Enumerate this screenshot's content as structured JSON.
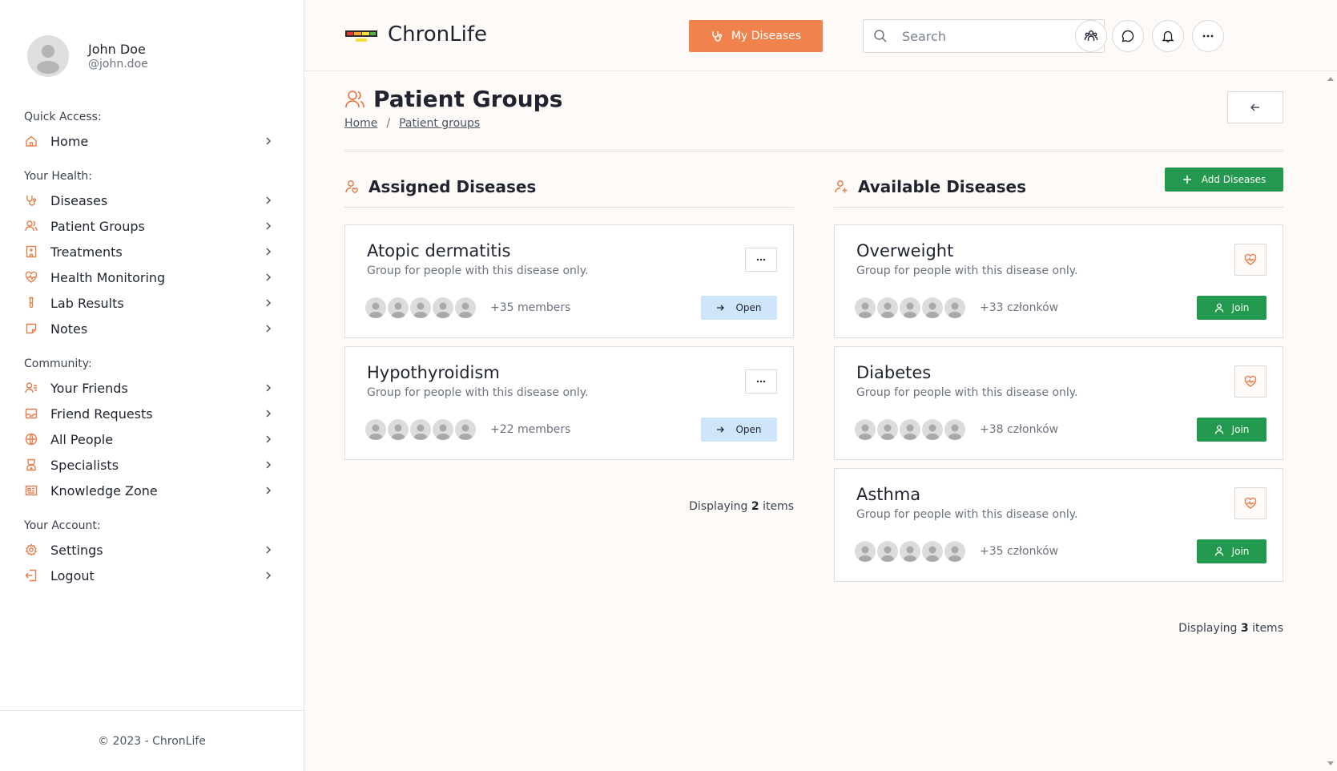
{
  "user": {
    "name": "John Doe",
    "handle": "@john.doe"
  },
  "sidebar": {
    "sections": [
      {
        "title": "Quick Access:",
        "items": [
          {
            "label": "Home",
            "icon": "home-icon"
          }
        ]
      },
      {
        "title": "Your Health:",
        "items": [
          {
            "label": "Diseases",
            "icon": "stethoscope-icon"
          },
          {
            "label": "Patient Groups",
            "icon": "users-icon"
          },
          {
            "label": "Treatments",
            "icon": "hospital-icon"
          },
          {
            "label": "Health Monitoring",
            "icon": "heart-pulse-icon"
          },
          {
            "label": "Lab Results",
            "icon": "test-tube-icon"
          },
          {
            "label": "Notes",
            "icon": "note-icon"
          }
        ]
      },
      {
        "title": "Community:",
        "items": [
          {
            "label": "Your Friends",
            "icon": "user-list-icon"
          },
          {
            "label": "Friend Requests",
            "icon": "inbox-icon"
          },
          {
            "label": "All People",
            "icon": "globe-icon"
          },
          {
            "label": "Specialists",
            "icon": "doctor-icon"
          },
          {
            "label": "Knowledge Zone",
            "icon": "newspaper-icon"
          }
        ]
      },
      {
        "title": "Your Account:",
        "items": [
          {
            "label": "Settings",
            "icon": "gear-icon"
          },
          {
            "label": "Logout",
            "icon": "logout-icon"
          }
        ]
      }
    ],
    "footer": "© 2023 - ChronLife"
  },
  "header": {
    "brand": "ChronLife",
    "my_diseases_label": "My Diseases",
    "search_placeholder": "Search"
  },
  "page": {
    "title": "Patient Groups",
    "breadcrumb": [
      "Home",
      "Patient groups"
    ],
    "breadcrumb_sep": "/"
  },
  "assigned": {
    "title": "Assigned Diseases",
    "open_label": "Open",
    "cards": [
      {
        "title": "Atopic dermatitis",
        "desc": "Group for people with this disease only.",
        "members": "+35 members"
      },
      {
        "title": "Hypothyroidism",
        "desc": "Group for people with this disease only.",
        "members": "+22 members"
      }
    ],
    "display_prefix": "Displaying",
    "display_count": "2",
    "display_suffix": "items"
  },
  "available": {
    "title": "Available Diseases",
    "add_label": "Add Diseases",
    "join_label": "Join",
    "cards": [
      {
        "title": "Overweight",
        "desc": "Group for people with this disease only.",
        "members": "+33 członków"
      },
      {
        "title": "Diabetes",
        "desc": "Group for people with this disease only.",
        "members": "+38 członków"
      },
      {
        "title": "Asthma",
        "desc": "Group for people with this disease only.",
        "members": "+35 członków"
      }
    ],
    "display_prefix": "Displaying",
    "display_count": "3",
    "display_suffix": "items"
  },
  "colors": {
    "accent": "#f0834d",
    "icon": "#e67e4d",
    "success": "#23994f",
    "open_bg": "#cfe5fb"
  }
}
